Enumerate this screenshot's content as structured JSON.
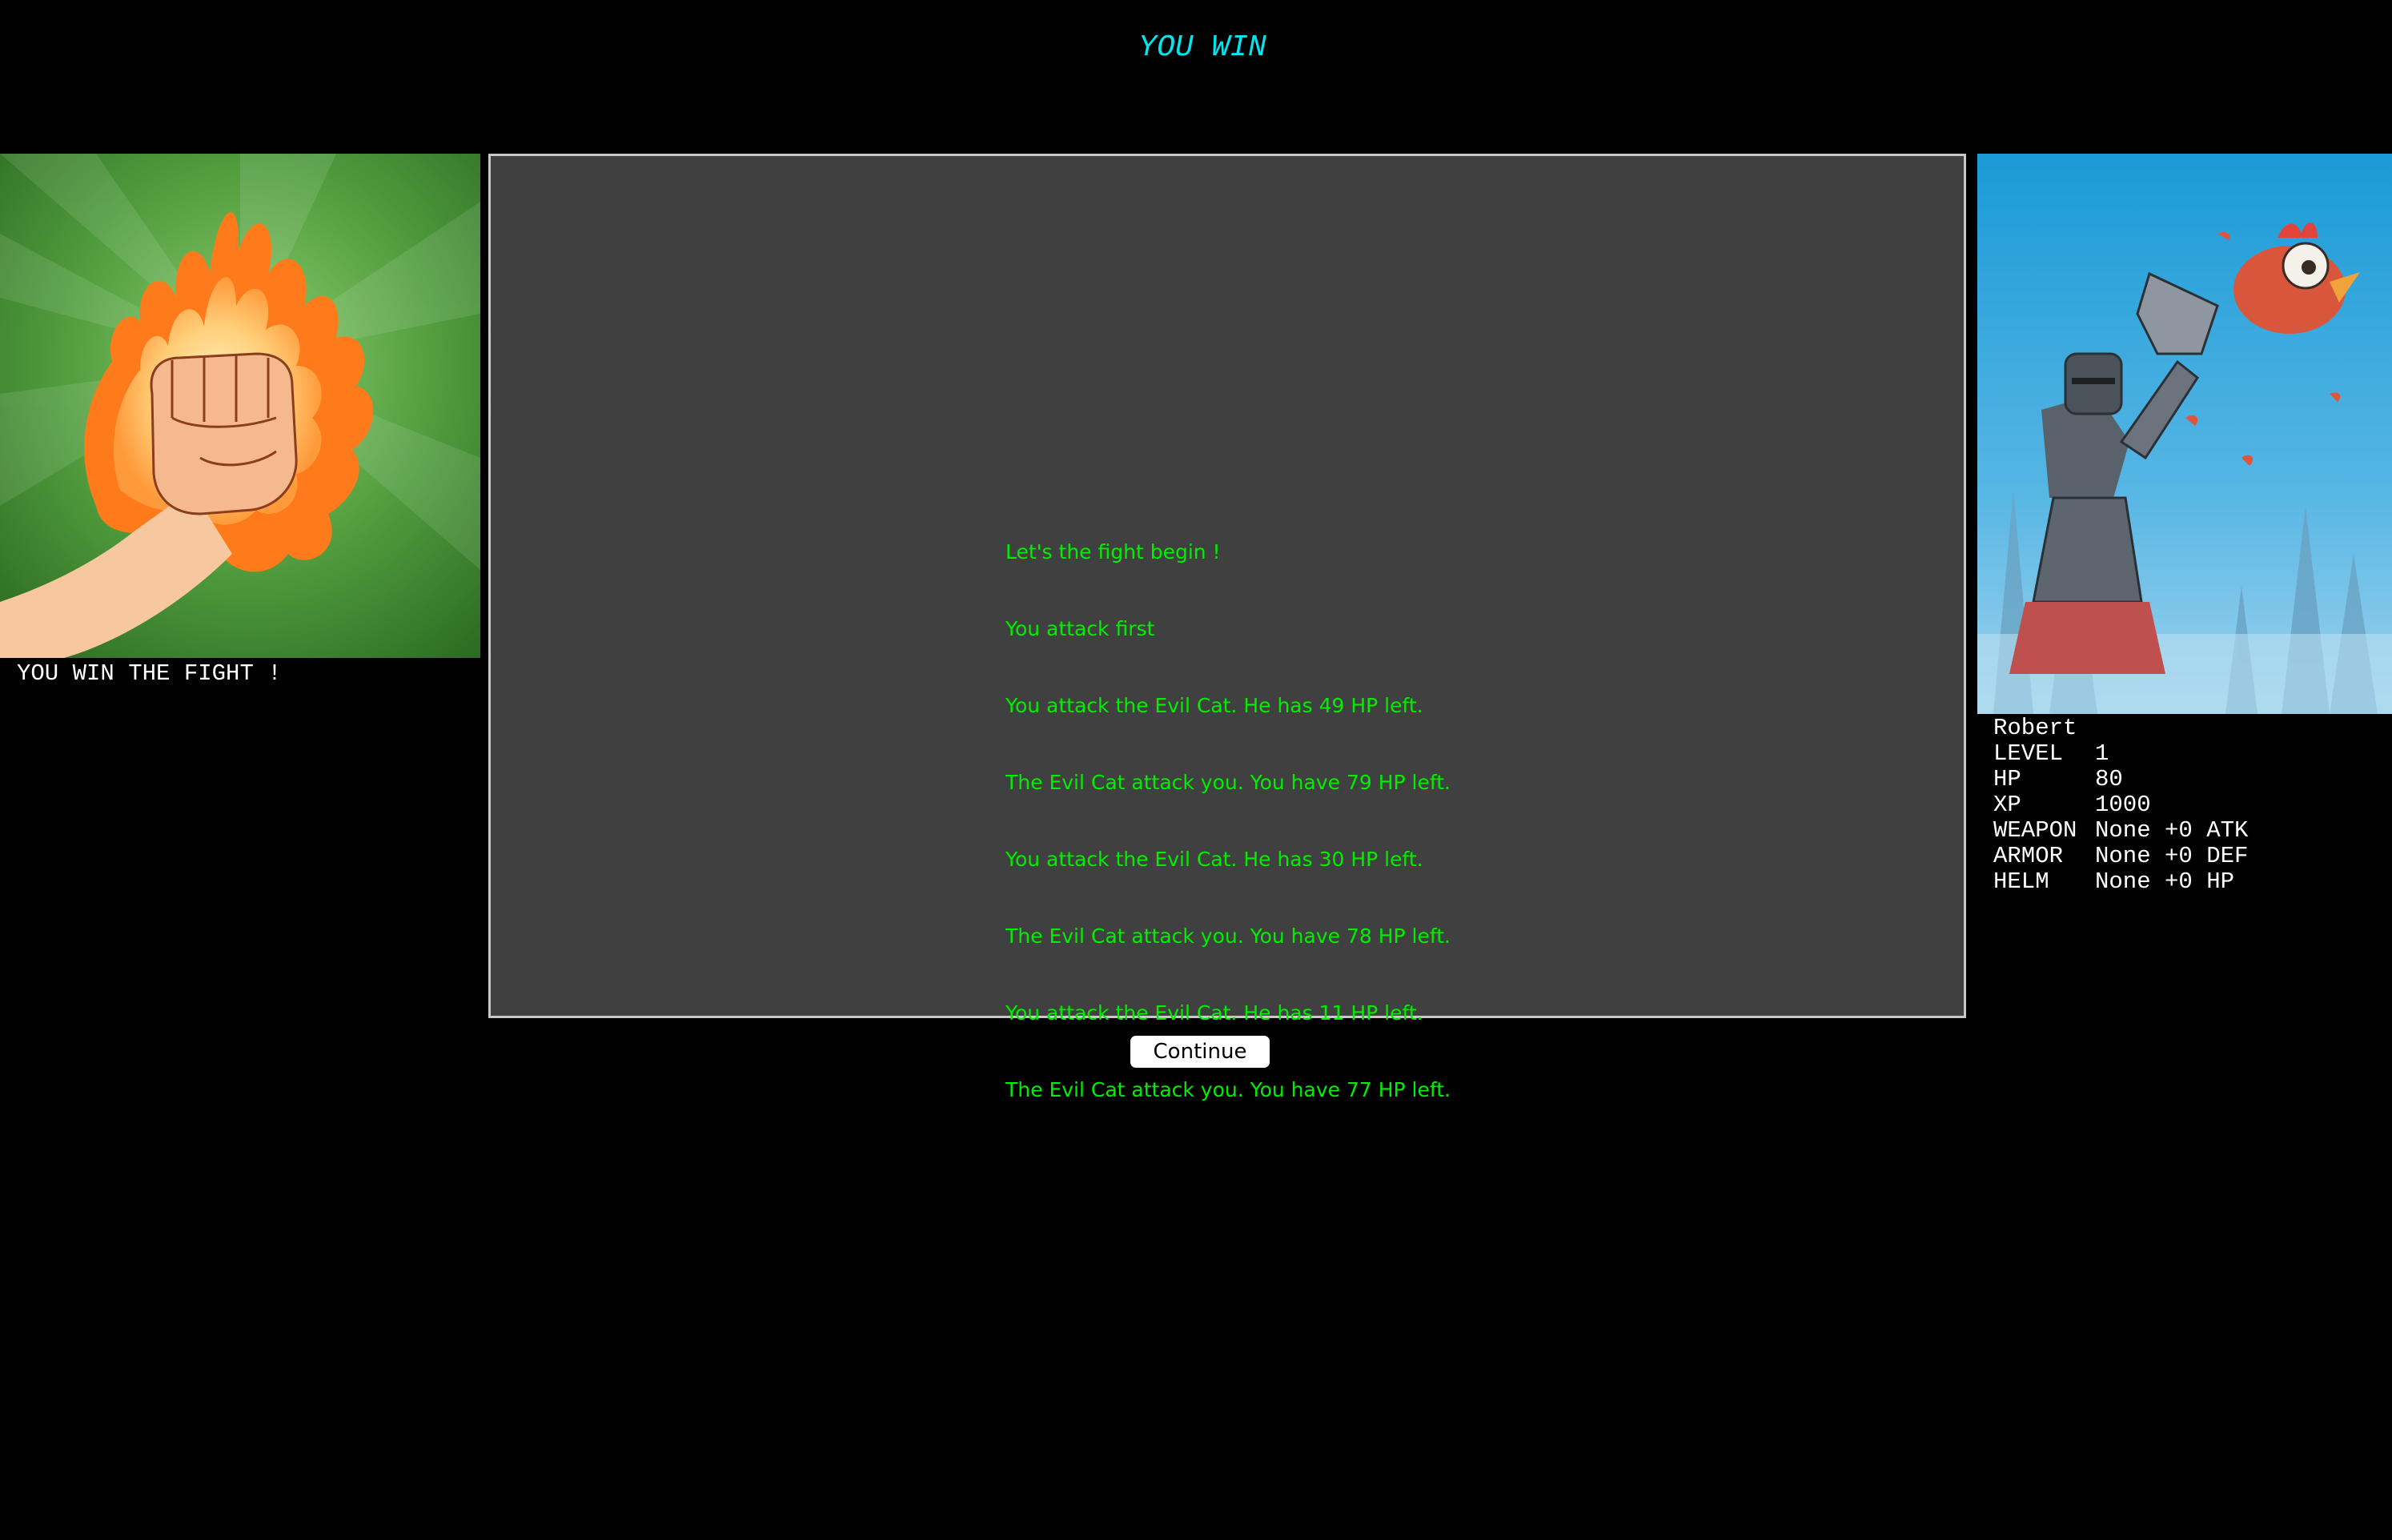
{
  "header": {
    "title": "YOU WIN"
  },
  "result_panel": {
    "image": "flaming-fist-icon",
    "caption": "YOU WIN THE FIGHT !"
  },
  "combat_log": {
    "lines": [
      "Let's the fight begin !",
      "You attack first",
      "You attack the Evil Cat. He has 49 HP left.",
      "The Evil Cat attack you. You have 79 HP left.",
      "You attack the Evil Cat. He has 30 HP left.",
      "The Evil Cat attack you. You have 78 HP left.",
      "You attack the Evil Cat. He has 11 HP left.",
      "The Evil Cat attack you. You have 77 HP left."
    ]
  },
  "player": {
    "portrait": "knight-portrait",
    "name": "Robert",
    "stats": [
      {
        "label": "LEVEL",
        "value": "1"
      },
      {
        "label": "HP",
        "value": "80"
      },
      {
        "label": "XP",
        "value": "1000"
      },
      {
        "label": "WEAPON",
        "value": "None +0 ATK"
      },
      {
        "label": "ARMOR",
        "value": "None +0 DEF"
      },
      {
        "label": "HELM",
        "value": "None +0 HP"
      }
    ]
  },
  "actions": {
    "continue_label": "Continue"
  },
  "colors": {
    "title": "#00e5ee",
    "log_text": "#00ee00",
    "log_background": "#404040",
    "page_background": "#000000"
  }
}
